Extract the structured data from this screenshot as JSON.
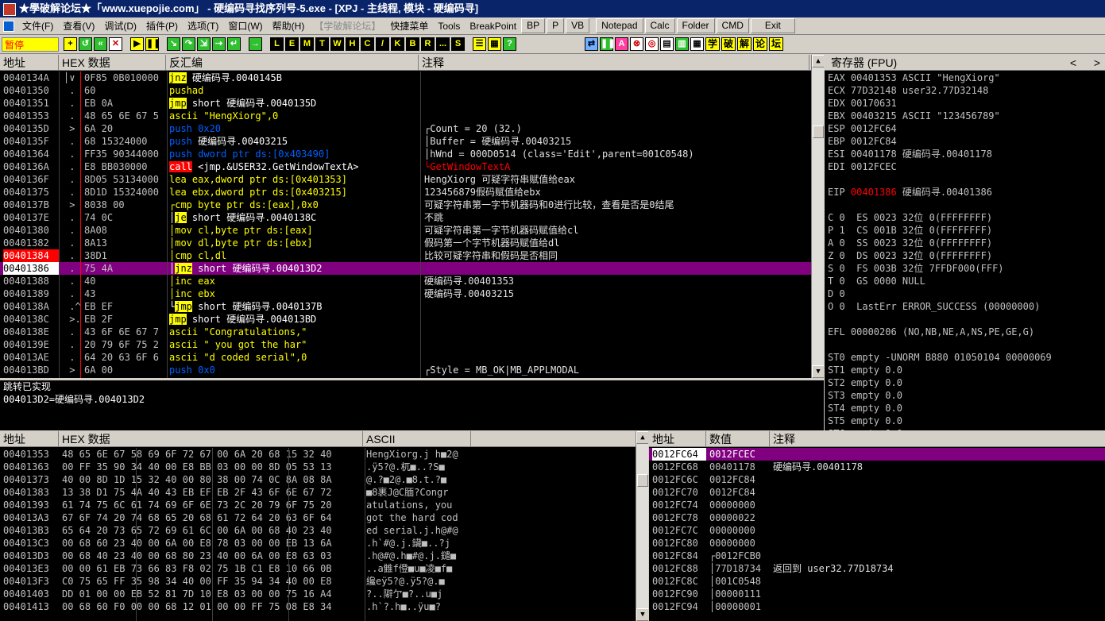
{
  "window": {
    "title": "★學破解论坛★「www.xuepojie.com」 - 硬编码寻找序列号-5.exe - [XPJ - 主线程, 模块 - 硬编码寻]"
  },
  "menu": {
    "items": [
      "文件(F)",
      "查看(V)",
      "调试(D)",
      "插件(P)",
      "选项(T)",
      "窗口(W)",
      "帮助(H)"
    ],
    "disabled": "【学破解论坛】",
    "extras": [
      "快捷菜单",
      "Tools",
      "BreakPoint",
      "BP",
      "P",
      "VB"
    ],
    "tools": [
      "Notepad",
      "Calc",
      "Folder",
      "CMD",
      "Exit"
    ]
  },
  "toolbar": {
    "status": "暂停",
    "letters": [
      "L",
      "E",
      "M",
      "T",
      "W",
      "H",
      "C",
      "/",
      "K",
      "B",
      "R",
      "...",
      "S"
    ],
    "right_letters": [
      "A"
    ],
    "cn": [
      "学",
      "破",
      "解",
      "论",
      "坛"
    ]
  },
  "cpu": {
    "headers": [
      "地址",
      "HEX 数据",
      "反汇编",
      "注释"
    ],
    "rows": [
      {
        "addr": "0040134A",
        "mark": "│∨",
        "hex": "0F85 0B010000",
        "dis": [
          [
            "jnz",
            "kw-jmp"
          ],
          [
            " 硬编码寻.0040145B",
            "wht"
          ]
        ],
        "cmt": ""
      },
      {
        "addr": "00401350",
        "mark": " .",
        "hex": "60",
        "dis": [
          [
            "pushad",
            "kw-yel"
          ]
        ],
        "cmt": ""
      },
      {
        "addr": "00401351",
        "mark": " .",
        "hex": "EB 0A",
        "dis": [
          [
            "jmp",
            "kw-jmp"
          ],
          [
            " short 硬编码寻.0040135D",
            "wht"
          ]
        ],
        "cmt": ""
      },
      {
        "addr": "00401353",
        "mark": " .",
        "hex": "48 65 6E 67 5",
        "dis": [
          [
            "ascii \"HengXiorg\",0",
            "kw-yel"
          ]
        ],
        "cmt": ""
      },
      {
        "addr": "0040135D",
        "mark": " >",
        "hex": "6A 20",
        "dis": [
          [
            "push 0x20",
            "kw-blue"
          ]
        ],
        "cmt": "┌Count = 20 (32.)"
      },
      {
        "addr": "0040135F",
        "mark": " .",
        "hex": "68 15324000",
        "dis": [
          [
            "push",
            "kw-blue"
          ],
          [
            " 硬编码寻.00403215",
            "wht"
          ]
        ],
        "cmt": "│Buffer = 硬编码寻.00403215"
      },
      {
        "addr": "00401364",
        "mark": " .",
        "hex": "FF35 90344000",
        "dis": [
          [
            "push dword ptr ds:[0x403490]",
            "kw-blue"
          ]
        ],
        "cmt": "│hWnd = 000D0514 (class='Edit',parent=001C0548)"
      },
      {
        "addr": "0040136A",
        "mark": " .",
        "hex": "E8 BB030000",
        "dis": [
          [
            "call",
            "kw-call"
          ],
          [
            " <jmp.&USER32.GetWindowTextA>",
            "wht"
          ]
        ],
        "cmt": "└GetWindowTextA"
      },
      {
        "addr": "0040136F",
        "mark": " .",
        "hex": "8D05 53134000",
        "dis": [
          [
            "lea eax,dword ptr ds:[0x401353]",
            "kw-yel"
          ]
        ],
        "cmt": "HengXiorg 可疑字符串赋值给eax"
      },
      {
        "addr": "00401375",
        "mark": " .",
        "hex": "8D1D 15324000",
        "dis": [
          [
            "lea ebx,dword ptr ds:[0x403215]",
            "kw-yel"
          ]
        ],
        "cmt": "123456879假码赋值给ebx"
      },
      {
        "addr": "0040137B",
        "mark": " >",
        "hex": "8038 00",
        "dis": [
          [
            "┌cmp byte ptr ds:[eax],0x0",
            "kw-yel"
          ]
        ],
        "cmt": "可疑字符串第一字节机器码和0进行比较，查看是否是0结尾"
      },
      {
        "addr": "0040137E",
        "mark": " .",
        "hex": "74 0C",
        "dis": [
          [
            "│",
            "wht"
          ],
          [
            "je",
            "kw-jmp"
          ],
          [
            " short 硬编码寻.0040138C",
            "wht"
          ]
        ],
        "cmt": "不跳"
      },
      {
        "addr": "00401380",
        "mark": " .",
        "hex": "8A08",
        "dis": [
          [
            "│mov cl,byte ptr ds:[eax]",
            "kw-yel"
          ]
        ],
        "cmt": "可疑字符串第一字节机器码赋值给cl"
      },
      {
        "addr": "00401382",
        "mark": " .",
        "hex": "8A13",
        "dis": [
          [
            "│mov dl,byte ptr ds:[ebx]",
            "kw-yel"
          ]
        ],
        "cmt": "假码第一个字节机器码赋值给dl"
      },
      {
        "addr": "00401384",
        "mark": " .",
        "hex": "38D1",
        "dis": [
          [
            "│cmp cl,dl",
            "kw-yel"
          ]
        ],
        "cmt": "比较可疑字符串和假码是否相同",
        "red": true
      },
      {
        "addr": "00401386",
        "mark": " .",
        "hex": "75 4A",
        "dis": [
          [
            "│",
            "wht"
          ],
          [
            "jnz",
            "kw-jmp"
          ],
          [
            " short 硬编码寻.004013D2",
            "wht"
          ]
        ],
        "cmt": "",
        "sel": true
      },
      {
        "addr": "00401388",
        "mark": " .",
        "hex": "40",
        "dis": [
          [
            "│inc eax",
            "kw-yel"
          ]
        ],
        "cmt": "硬编码寻.00401353"
      },
      {
        "addr": "00401389",
        "mark": " .",
        "hex": "43",
        "dis": [
          [
            "│inc ebx",
            "kw-yel"
          ]
        ],
        "cmt": "硬编码寻.00403215"
      },
      {
        "addr": "0040138A",
        "mark": " .^",
        "hex": "EB EF",
        "dis": [
          [
            "└",
            "wht"
          ],
          [
            "jmp",
            "kw-jmp"
          ],
          [
            " short 硬编码寻.0040137B",
            "wht"
          ]
        ],
        "cmt": ""
      },
      {
        "addr": "0040138C",
        "mark": " >.",
        "hex": "EB 2F",
        "dis": [
          [
            "jmp",
            "kw-jmp"
          ],
          [
            " short 硬编码寻.004013BD",
            "wht"
          ]
        ],
        "cmt": ""
      },
      {
        "addr": "0040138E",
        "mark": " .",
        "hex": "43 6F 6E 67 7",
        "dis": [
          [
            "ascii \"Congratulations,\"",
            "kw-yel"
          ]
        ],
        "cmt": ""
      },
      {
        "addr": "0040139E",
        "mark": " .",
        "hex": "20 79 6F 75 2",
        "dis": [
          [
            "ascii \" you got the har\"",
            "kw-yel"
          ]
        ],
        "cmt": ""
      },
      {
        "addr": "004013AE",
        "mark": " .",
        "hex": "64 20 63 6F 6",
        "dis": [
          [
            "ascii \"d coded serial\",0",
            "kw-yel"
          ]
        ],
        "cmt": ""
      },
      {
        "addr": "004013BD",
        "mark": " >",
        "hex": "6A 00",
        "dis": [
          [
            "push 0x0",
            "kw-blue"
          ]
        ],
        "cmt": "┌Style = MB_OK|MB_APPLMODAL"
      }
    ]
  },
  "info": {
    "line1": "跳转已实现",
    "line2": "004013D2=硬编码寻.004013D2"
  },
  "registers": {
    "header": "寄存器 (FPU)",
    "lines": [
      "EAX 00401353 ASCII \"HengXiorg\"",
      "ECX 77D32148 user32.77D32148",
      "EDX 00170631",
      "EBX 00403215 ASCII \"123456789\"",
      "ESP 0012FC64",
      "EBP 0012FC84",
      "ESI 00401178 硬编码寻.00401178",
      "EDI 0012FCEC",
      "",
      "EIP|00401386|硬编码寻.00401386",
      "",
      "C 0  ES 0023 32位 0(FFFFFFFF)",
      "P 1  CS 001B 32位 0(FFFFFFFF)",
      "A 0  SS 0023 32位 0(FFFFFFFF)",
      "Z 0  DS 0023 32位 0(FFFFFFFF)",
      "S 0  FS 003B 32位 7FFDF000(FFF)",
      "T 0  GS 0000 NULL",
      "D 0",
      "O 0  LastErr ERROR_SUCCESS (00000000)",
      "",
      "EFL 00000206 (NO,NB,NE,A,NS,PE,GE,G)",
      "",
      "ST0 empty -UNORM B880 01050104 00000069",
      "ST1 empty 0.0",
      "ST2 empty 0.0",
      "ST3 empty 0.0",
      "ST4 empty 0.0",
      "ST5 empty 0.0",
      "ST6 empty 0.0",
      "ST7 empty 0.0"
    ]
  },
  "dump": {
    "headers": [
      "地址",
      "HEX 数据",
      "ASCII"
    ],
    "rows": [
      {
        "addr": "00401353",
        "hex": "48 65 6E 67 58 69 6F 72 67 00 6A 20 68 15 32 40",
        "ascii": "HengXiorg.j h■2@"
      },
      {
        "addr": "00401363",
        "hex": "00 FF 35 90 34 40 00 E8 BB 03 00 00 8D 05 53 13",
        "ascii": ".ÿ5?@.杌■..?S■"
      },
      {
        "addr": "00401373",
        "hex": "40 00 8D 1D 15 32 40 00 80 38 00 74 0C 8A 08 8A",
        "ascii": "@.?■2@.■8.t.?■"
      },
      {
        "addr": "00401383",
        "hex": "13 38 D1 75 4A 40 43 EB EF EB 2F 43 6F 6E 67 72",
        "ascii": "■8裹J@C腼?Congr"
      },
      {
        "addr": "00401393",
        "hex": "61 74 75 6C 61 74 69 6F 6E 73 2C 20 79 6F 75 20",
        "ascii": "atulations, you "
      },
      {
        "addr": "004013A3",
        "hex": "67 6F 74 20 74 68 65 20 68 61 72 64 20 63 6F 64",
        "ascii": "got the hard cod"
      },
      {
        "addr": "004013B3",
        "hex": "65 64 20 73 65 72 69 61 6C 00 6A 00 68 40 23 40",
        "ascii": "ed serial.j.h@#@"
      },
      {
        "addr": "004013C3",
        "hex": "00 68 60 23 40 00 6A 00 E8 78 03 00 00 EB 13 6A",
        "ascii": ".h`#@.j.鑶■..?j"
      },
      {
        "addr": "004013D3",
        "hex": "00 68 40 23 40 00 68 80 23 40 00 6A 00 E8 63 03",
        "ascii": ".h@#@.h■#@.j.鑓■"
      },
      {
        "addr": "004013E3",
        "hex": "00 00 61 EB 73 66 83 F8 02 75 1B C1 E8 10 66 0B",
        "ascii": "..a雔f僜■u■凌■f■"
      },
      {
        "addr": "004013F3",
        "hex": "C0 75 65 FF 35 98 34 40 00 FF 35 94 34 40 00 E8",
        "ascii": "纔eÿ5?@.ÿ5?@.■"
      },
      {
        "addr": "00401403",
        "hex": "DD 01 00 00 EB 52 81 7D 10 E8 03 00 00 75 16 A4",
        "ascii": "?..隦亇■?..u■j"
      },
      {
        "addr": "00401413",
        "hex": "00 68 60 F0 00 00 68 12 01 00 00 FF 75 08 E8 34",
        "ascii": ".h`?.h■..ÿu■?"
      }
    ]
  },
  "stack": {
    "headers": [
      "地址",
      "数值",
      "注释"
    ],
    "rows": [
      {
        "addr": "0012FC64",
        "val": "0012FCEC",
        "cmt": "",
        "sel": true
      },
      {
        "addr": "0012FC68",
        "val": "00401178",
        "cmt": "硬编码寻.00401178"
      },
      {
        "addr": "0012FC6C",
        "val": "0012FC84",
        "cmt": ""
      },
      {
        "addr": "0012FC70",
        "val": "0012FC84",
        "cmt": ""
      },
      {
        "addr": "0012FC74",
        "val": "00000000",
        "cmt": ""
      },
      {
        "addr": "0012FC78",
        "val": "00000022",
        "cmt": ""
      },
      {
        "addr": "0012FC7C",
        "val": "00000000",
        "cmt": ""
      },
      {
        "addr": "0012FC80",
        "val": "00000000",
        "cmt": ""
      },
      {
        "addr": "0012FC84",
        "val": "┌0012FCB0",
        "cmt": ""
      },
      {
        "addr": "0012FC88",
        "val": "│77D18734",
        "cmt": "返回到 user32.77D18734"
      },
      {
        "addr": "0012FC8C",
        "val": "│001C0548",
        "cmt": ""
      },
      {
        "addr": "0012FC90",
        "val": "│00000111",
        "cmt": ""
      },
      {
        "addr": "0012FC94",
        "val": "│00000001",
        "cmt": ""
      }
    ]
  }
}
